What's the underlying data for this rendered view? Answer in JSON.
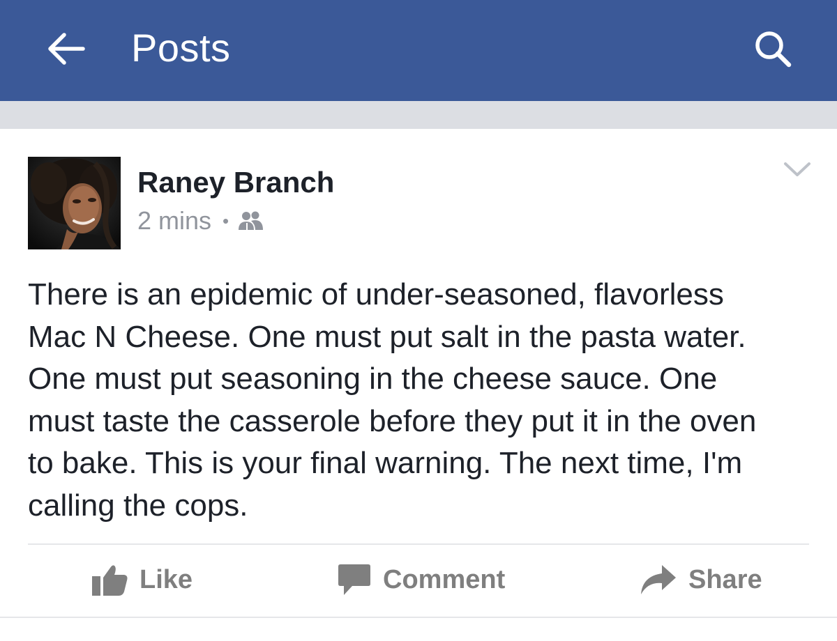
{
  "header": {
    "title": "Posts",
    "back_icon": "arrow-left-icon",
    "search_icon": "search-icon",
    "background_color": "#3b5998"
  },
  "post": {
    "author": "Raney Branch",
    "time": "2 mins",
    "separator": "•",
    "audience_icon": "friends-icon",
    "menu_icon": "chevron-down-icon",
    "text": "There is an epidemic of under-seasoned, flavorless\nMac N Cheese.  One must put salt in the pasta water.\nOne must put seasoning in the cheese sauce. One\nmust taste the casserole before they put it in the oven\nto bake. This is your final warning. The next time, I'm\ncalling the cops."
  },
  "actions": {
    "like_label": "Like",
    "like_icon": "thumbs-up-icon",
    "comment_label": "Comment",
    "comment_icon": "speech-bubble-icon",
    "share_label": "Share",
    "share_icon": "share-arrow-icon"
  }
}
